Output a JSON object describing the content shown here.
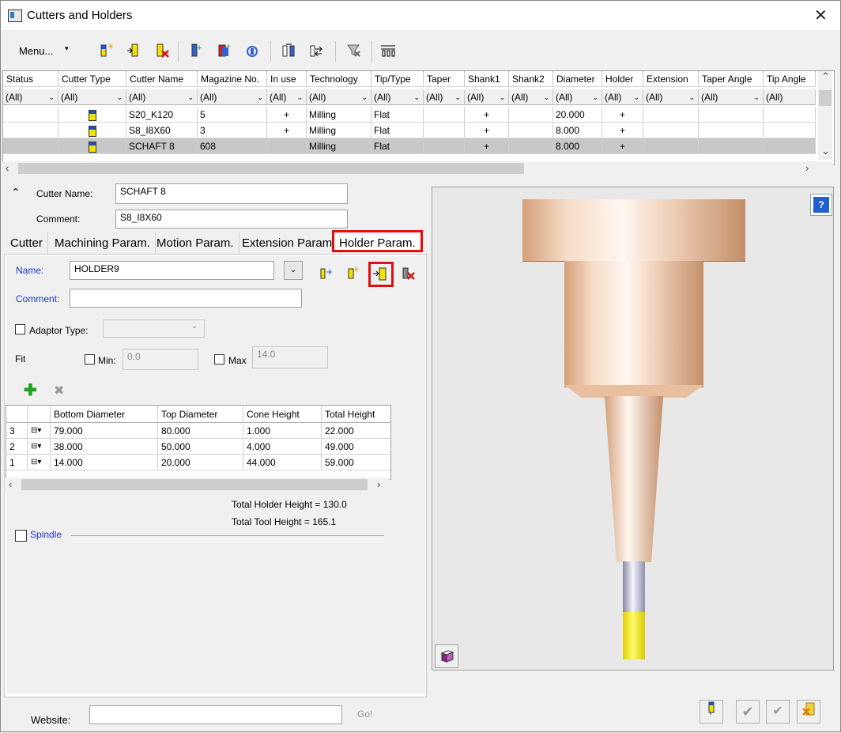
{
  "window": {
    "title": "Cutters and Holders",
    "close_glyph": "✕"
  },
  "toolbar": {
    "menu_label": "Menu...",
    "menu_arrow": "▾"
  },
  "grid": {
    "columns": [
      "Status",
      "Cutter Type",
      "Cutter Name",
      "Magazine No.",
      "In use",
      "Technology",
      "Tip/Type",
      "Taper",
      "Shank1",
      "Shank2",
      "Diameter",
      "Holder",
      "Extension",
      "Taper Angle",
      "Tip Angle"
    ],
    "filter_value": "(All)",
    "rows": [
      {
        "status": "",
        "type_icon": "tool-icon",
        "name": "S20_K120",
        "magazine": "5",
        "in_use": "+",
        "technology": "Milling",
        "tip": "Flat",
        "taper": "",
        "shank1": "+",
        "shank2": "",
        "diameter": "20.000",
        "holder": "+",
        "extension": "",
        "taper_angle": "",
        "tip_angle": ""
      },
      {
        "status": "",
        "type_icon": "tool-icon",
        "name": "S8_I8X60",
        "magazine": "3",
        "in_use": "+",
        "technology": "Milling",
        "tip": "Flat",
        "taper": "",
        "shank1": "+",
        "shank2": "",
        "diameter": "8.000",
        "holder": "+",
        "extension": "",
        "taper_angle": "",
        "tip_angle": ""
      },
      {
        "status": "",
        "type_icon": "tool-icon",
        "name": "SCHAFT 8",
        "magazine": "608",
        "in_use": "",
        "technology": "Milling",
        "tip": "Flat",
        "taper": "",
        "shank1": "+",
        "shank2": "",
        "diameter": "8.000",
        "holder": "+",
        "extension": "",
        "taper_angle": "",
        "tip_angle": "",
        "selected": true
      }
    ]
  },
  "form": {
    "cutter_name_label": "Cutter Name:",
    "cutter_name_value": "SCHAFT 8",
    "comment_label": "Comment:",
    "comment_value": "S8_I8X60"
  },
  "tabs": [
    "Cutter",
    "Machining Param.",
    "Motion Param.",
    "Extension Param.",
    "Holder Param."
  ],
  "active_tab": "Holder Param.",
  "holder": {
    "name_label": "Name:",
    "name_value": "HOLDER9",
    "comment_label": "Comment:",
    "comment_value": "",
    "adaptor_label": "Adaptor Type:",
    "fit_label": "Fit",
    "min_label": "Min:",
    "min_value": "0.0",
    "max_label": "Max",
    "max_value": "14.0",
    "table_columns": [
      "Bottom Diameter",
      "Top Diameter",
      "Cone Height",
      "Total Height"
    ],
    "table_rows": [
      {
        "idx": "3",
        "bottom": "79.000",
        "top": "80.000",
        "cone": "1.000",
        "total": "22.000"
      },
      {
        "idx": "2",
        "bottom": "38.000",
        "top": "50.000",
        "cone": "4.000",
        "total": "49.000"
      },
      {
        "idx": "1",
        "bottom": "14.000",
        "top": "20.000",
        "cone": "44.000",
        "total": "59.000"
      }
    ],
    "total_holder_height": "Total Holder Height = 130.0",
    "total_tool_height": "Total Tool Height = 165.1",
    "spindle_label": "Spindle"
  },
  "bottom": {
    "website_label": "Website:",
    "website_value": "",
    "go_label": "Go!"
  },
  "colors": {
    "highlight": "#e01010",
    "link_blue": "#1a33d0",
    "copper": "#e8b898",
    "tip_yellow": "#f4e600"
  }
}
